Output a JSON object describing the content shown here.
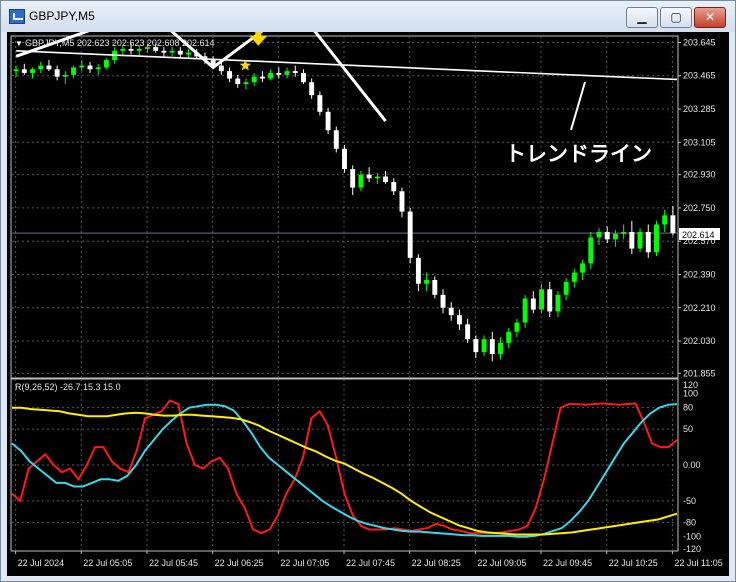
{
  "window": {
    "title": "GBPJPY,M5",
    "controls": {
      "minimize": "▁",
      "maximize": "▢",
      "close": "✕"
    }
  },
  "main_chart": {
    "header": "GBPJPY,M5  202.623 202.623 202.608 202.614",
    "price_ticks": [
      "203.645",
      "203.465",
      "203.285",
      "203.105",
      "202.930",
      "202.750",
      "202.570",
      "202.390",
      "202.210",
      "202.030",
      "201.855"
    ],
    "current_price": "202.614",
    "annotation": "トレンドライン",
    "colors": {
      "bull": "#00ff00",
      "bear": "#ffffff",
      "background": "#000000",
      "trendline": "#ffffff",
      "signal_arrow": "#ffd700"
    }
  },
  "indicator": {
    "header": "R(9,26,52) -26.7 15.3 15.0",
    "ticks": [
      "120",
      "100",
      "80",
      "50",
      "0.00",
      "-50",
      "-80",
      "-100",
      "-120"
    ],
    "series_colors": {
      "fast": "#ff1a1a",
      "mid": "#38d8e8",
      "slow": "#ffee00"
    }
  },
  "time_axis": {
    "labels": [
      "22 Jul 2024",
      "22 Jul 05:05",
      "22 Jul 05:45",
      "22 Jul 06:25",
      "22 Jul 07:05",
      "22 Jul 07:45",
      "22 Jul 08:25",
      "22 Jul 09:05",
      "22 Jul 09:45",
      "22 Jul 10:25",
      "22 Jul 11:05"
    ]
  },
  "chart_data": [
    {
      "type": "candlestick",
      "series": [
        {
          "name": "GBPJPY,M5",
          "candles": [
            [
              203.49,
              203.52,
              203.46,
              203.5
            ],
            [
              203.5,
              203.53,
              203.47,
              203.48
            ],
            [
              203.48,
              203.51,
              203.45,
              203.5
            ],
            [
              203.5,
              203.54,
              203.48,
              203.52
            ],
            [
              203.52,
              203.55,
              203.49,
              203.5
            ],
            [
              203.5,
              203.52,
              203.44,
              203.46
            ],
            [
              203.46,
              203.49,
              203.42,
              203.47
            ],
            [
              203.47,
              203.52,
              203.45,
              203.51
            ],
            [
              203.51,
              203.55,
              203.49,
              203.52
            ],
            [
              203.52,
              203.54,
              203.48,
              203.5
            ],
            [
              203.5,
              203.53,
              203.47,
              203.51
            ],
            [
              203.51,
              203.56,
              203.5,
              203.55
            ],
            [
              203.55,
              203.62,
              203.53,
              203.6
            ],
            [
              203.6,
              203.63,
              203.57,
              203.61
            ],
            [
              203.61,
              203.64,
              203.58,
              203.6
            ],
            [
              203.6,
              203.63,
              203.57,
              203.61
            ],
            [
              203.61,
              203.64,
              203.59,
              203.62
            ],
            [
              203.62,
              203.64,
              203.59,
              203.6
            ],
            [
              203.6,
              203.62,
              203.57,
              203.59
            ],
            [
              203.59,
              203.62,
              203.57,
              203.6
            ],
            [
              203.6,
              203.62,
              203.56,
              203.58
            ],
            [
              203.58,
              203.61,
              203.56,
              203.59
            ],
            [
              203.59,
              203.61,
              203.56,
              203.57
            ],
            [
              203.57,
              203.59,
              203.53,
              203.55
            ],
            [
              203.55,
              203.57,
              203.5,
              203.52
            ],
            [
              203.52,
              203.54,
              203.47,
              203.49
            ],
            [
              203.49,
              203.51,
              203.43,
              203.45
            ],
            [
              203.45,
              203.47,
              203.4,
              203.42
            ],
            [
              203.42,
              203.45,
              203.39,
              203.43
            ],
            [
              203.43,
              203.48,
              203.41,
              203.46
            ],
            [
              203.46,
              203.49,
              203.43,
              203.45
            ],
            [
              203.45,
              203.5,
              203.44,
              203.48
            ],
            [
              203.48,
              203.51,
              203.45,
              203.47
            ],
            [
              203.47,
              203.51,
              203.45,
              203.49
            ],
            [
              203.49,
              203.52,
              203.46,
              203.48
            ],
            [
              203.48,
              203.5,
              203.42,
              203.43
            ],
            [
              203.43,
              203.45,
              203.34,
              203.36
            ],
            [
              203.36,
              203.38,
              203.25,
              203.27
            ],
            [
              203.27,
              203.29,
              203.15,
              203.17
            ],
            [
              203.17,
              203.19,
              203.05,
              203.07
            ],
            [
              203.07,
              203.09,
              202.94,
              202.96
            ],
            [
              202.96,
              202.98,
              202.82,
              202.86
            ],
            [
              202.86,
              202.95,
              202.84,
              202.93
            ],
            [
              202.93,
              202.97,
              202.89,
              202.91
            ],
            [
              202.91,
              202.94,
              202.88,
              202.92
            ],
            [
              202.92,
              202.95,
              202.88,
              202.89
            ],
            [
              202.89,
              202.91,
              202.82,
              202.84
            ],
            [
              202.84,
              202.86,
              202.7,
              202.73
            ],
            [
              202.73,
              202.75,
              202.45,
              202.48
            ],
            [
              202.48,
              202.5,
              202.3,
              202.34
            ],
            [
              202.34,
              202.4,
              202.3,
              202.36
            ],
            [
              202.36,
              202.38,
              202.26,
              202.28
            ],
            [
              202.28,
              202.31,
              202.18,
              202.21
            ],
            [
              202.21,
              202.24,
              202.14,
              202.17
            ],
            [
              202.17,
              202.2,
              202.09,
              202.12
            ],
            [
              202.12,
              202.15,
              202.02,
              202.04
            ],
            [
              202.04,
              202.06,
              201.94,
              201.97
            ],
            [
              201.97,
              202.06,
              201.95,
              202.04
            ],
            [
              202.04,
              202.08,
              201.92,
              201.96
            ],
            [
              201.96,
              202.05,
              201.93,
              202.02
            ],
            [
              202.02,
              202.1,
              201.99,
              202.08
            ],
            [
              202.08,
              202.15,
              202.05,
              202.13
            ],
            [
              202.13,
              202.28,
              202.1,
              202.26
            ],
            [
              202.26,
              202.3,
              202.18,
              202.2
            ],
            [
              202.2,
              202.34,
              202.18,
              202.31
            ],
            [
              202.31,
              202.35,
              202.16,
              202.19
            ],
            [
              202.19,
              202.3,
              202.16,
              202.28
            ],
            [
              202.28,
              202.37,
              202.25,
              202.35
            ],
            [
              202.35,
              202.42,
              202.32,
              202.4
            ],
            [
              202.4,
              202.47,
              202.36,
              202.45
            ],
            [
              202.45,
              202.62,
              202.42,
              202.59
            ],
            [
              202.59,
              202.64,
              202.55,
              202.62
            ],
            [
              202.62,
              202.65,
              202.56,
              202.58
            ],
            [
              202.58,
              202.63,
              202.54,
              202.61
            ],
            [
              202.61,
              202.66,
              202.58,
              202.62
            ],
            [
              202.62,
              202.68,
              202.5,
              202.53
            ],
            [
              202.53,
              202.64,
              202.51,
              202.62
            ],
            [
              202.62,
              202.66,
              202.48,
              202.51
            ],
            [
              202.51,
              202.68,
              202.49,
              202.66
            ],
            [
              202.66,
              202.74,
              202.62,
              202.71
            ],
            [
              202.71,
              202.76,
              202.6,
              202.614
            ]
          ]
        }
      ],
      "price_axis": [
        "203.645",
        "203.465",
        "203.285",
        "203.105",
        "202.930",
        "202.750",
        "202.570",
        "202.390",
        "202.210",
        "202.030",
        "201.855"
      ],
      "ylim": [
        201.83,
        203.68
      ],
      "trendline": {
        "start": [
          0,
          203.6
        ],
        "end": [
          80,
          203.445
        ]
      },
      "zigzag": [
        [
          0,
          203.57
        ],
        [
          16,
          203.82
        ],
        [
          24,
          203.51
        ],
        [
          34,
          203.84
        ],
        [
          45,
          203.22
        ]
      ],
      "arrow_at": 29.5,
      "annotation": "トレンドライン"
    },
    {
      "type": "line",
      "title": "R(9,26,52)",
      "ylim": [
        -120,
        120
      ],
      "yticks": [
        120,
        100,
        80,
        50,
        0,
        -50,
        -80,
        -100,
        -120
      ],
      "series": [
        {
          "values": [
            -40,
            -50,
            -5,
            5,
            15,
            0,
            -10,
            -5,
            -20,
            0,
            25,
            25,
            5,
            -5,
            -10,
            20,
            65,
            70,
            75,
            90,
            85,
            30,
            0,
            -5,
            5,
            10,
            -5,
            -40,
            -60,
            -90,
            -95,
            -90,
            -70,
            -40,
            -20,
            10,
            65,
            75,
            55,
            10,
            -40,
            -70,
            -85,
            -90,
            -90,
            -90,
            -88,
            -90,
            -92,
            -90,
            -88,
            -82,
            -85,
            -90,
            -92,
            -95,
            -95,
            -95,
            -95,
            -94,
            -92,
            -90,
            -85,
            -60,
            -20,
            30,
            80,
            85,
            85,
            84,
            85,
            86,
            85,
            84,
            85,
            86,
            60,
            30,
            25,
            25,
            35
          ]
        },
        {
          "values": [
            30,
            20,
            5,
            -5,
            -15,
            -25,
            -25,
            -30,
            -30,
            -25,
            -20,
            -20,
            -22,
            -15,
            0,
            20,
            35,
            50,
            62,
            72,
            80,
            82,
            84,
            84,
            82,
            76,
            62,
            45,
            25,
            10,
            0,
            -10,
            -20,
            -30,
            -40,
            -50,
            -58,
            -65,
            -72,
            -78,
            -82,
            -85,
            -88,
            -90,
            -92,
            -93,
            -93,
            -94,
            -95,
            -96,
            -97,
            -98,
            -98,
            -99,
            -99,
            -99,
            -99,
            -100,
            -100,
            -99,
            -96,
            -92,
            -88,
            -78,
            -65,
            -50,
            -30,
            -10,
            10,
            30,
            45,
            60,
            72,
            80,
            84,
            85
          ]
        },
        {
          "values": [
            80,
            80,
            78,
            77,
            76,
            75,
            72,
            70,
            68,
            68,
            68,
            70,
            72,
            73,
            72,
            70,
            69,
            69,
            70,
            70,
            69,
            68,
            67,
            66,
            64,
            60,
            55,
            48,
            42,
            36,
            30,
            24,
            19,
            12,
            6,
            2,
            -5,
            -12,
            -18,
            -25,
            -32,
            -40,
            -50,
            -58,
            -66,
            -72,
            -78,
            -84,
            -88,
            -92,
            -94,
            -95,
            -96,
            -97,
            -97,
            -97,
            -97,
            -96,
            -95,
            -94,
            -92,
            -90,
            -88,
            -86,
            -84,
            -82,
            -80,
            -78,
            -76,
            -72,
            -68
          ]
        }
      ]
    }
  ]
}
